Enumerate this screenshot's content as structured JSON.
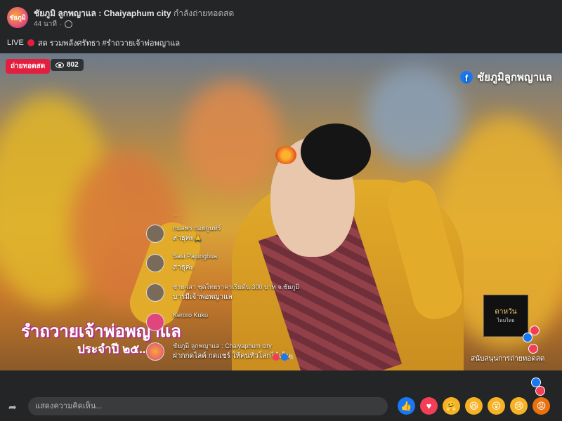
{
  "post": {
    "page_name": "ชัยภูมิ ลูกพญาแล : Chaiyaphum city",
    "status": "กำลังถ่ายทอดสด",
    "time_ago": "44 นาที",
    "avatar_text": "ชัยภูมิ",
    "caption_live": "LIVE",
    "caption_text": "สด  รวมพลังศรัทธา #รำถวายเจ้าพ่อพญาแล"
  },
  "video": {
    "live_badge": "ถ่ายทอดสด",
    "viewer_count": "802",
    "watermark": "ชัยภูมิลูกพญาแล",
    "overlay_title": "รำถวายเจ้าพ่อพญาแล",
    "overlay_subtitle": "ประจำปี ๒๕...",
    "sponsor_text": "ดาหวัน",
    "sponsor_small": "ไหมไทย",
    "sponsor_caption": "สนับสนุนการถ่ายทอดสด"
  },
  "comments": [
    {
      "name": "...",
      "text": "",
      "faded": true
    },
    {
      "name": "กมลพร กอยจูนทร์",
      "text": "สาธุค่ะ🙏"
    },
    {
      "name": "Sasi Pajungbua",
      "text": "สาธุค่ะ"
    },
    {
      "name": "ชาย-เสา ชุดไทยราคาเริ่มต้น 300 บาท จ.ชัยภูมิ",
      "text": "บารมีเจ้าพ่อพญาแล"
    },
    {
      "name": "Keroro Kuku",
      "text": ""
    },
    {
      "name": "ชัยภูมิ ลูกพญาแล : Chaiyaphum city",
      "text": "ฝากกดไลค์ กดแชร์ ให้คนทั่วโลกได้เห็น",
      "reaction_count": "3"
    }
  ],
  "composer": {
    "placeholder": "แสดงความคิดเห็น..."
  },
  "reactions": [
    {
      "name": "like",
      "glyph": "👍",
      "color": "#1877f2"
    },
    {
      "name": "love",
      "glyph": "♥",
      "color": "#f33e58"
    },
    {
      "name": "care",
      "glyph": "🤗",
      "color": "#f7b125"
    },
    {
      "name": "haha",
      "glyph": "😆",
      "color": "#f7b125"
    },
    {
      "name": "wow",
      "glyph": "😮",
      "color": "#f7b125"
    },
    {
      "name": "sad",
      "glyph": "😢",
      "color": "#f7b125"
    },
    {
      "name": "angry",
      "glyph": "😡",
      "color": "#e9710f"
    }
  ]
}
